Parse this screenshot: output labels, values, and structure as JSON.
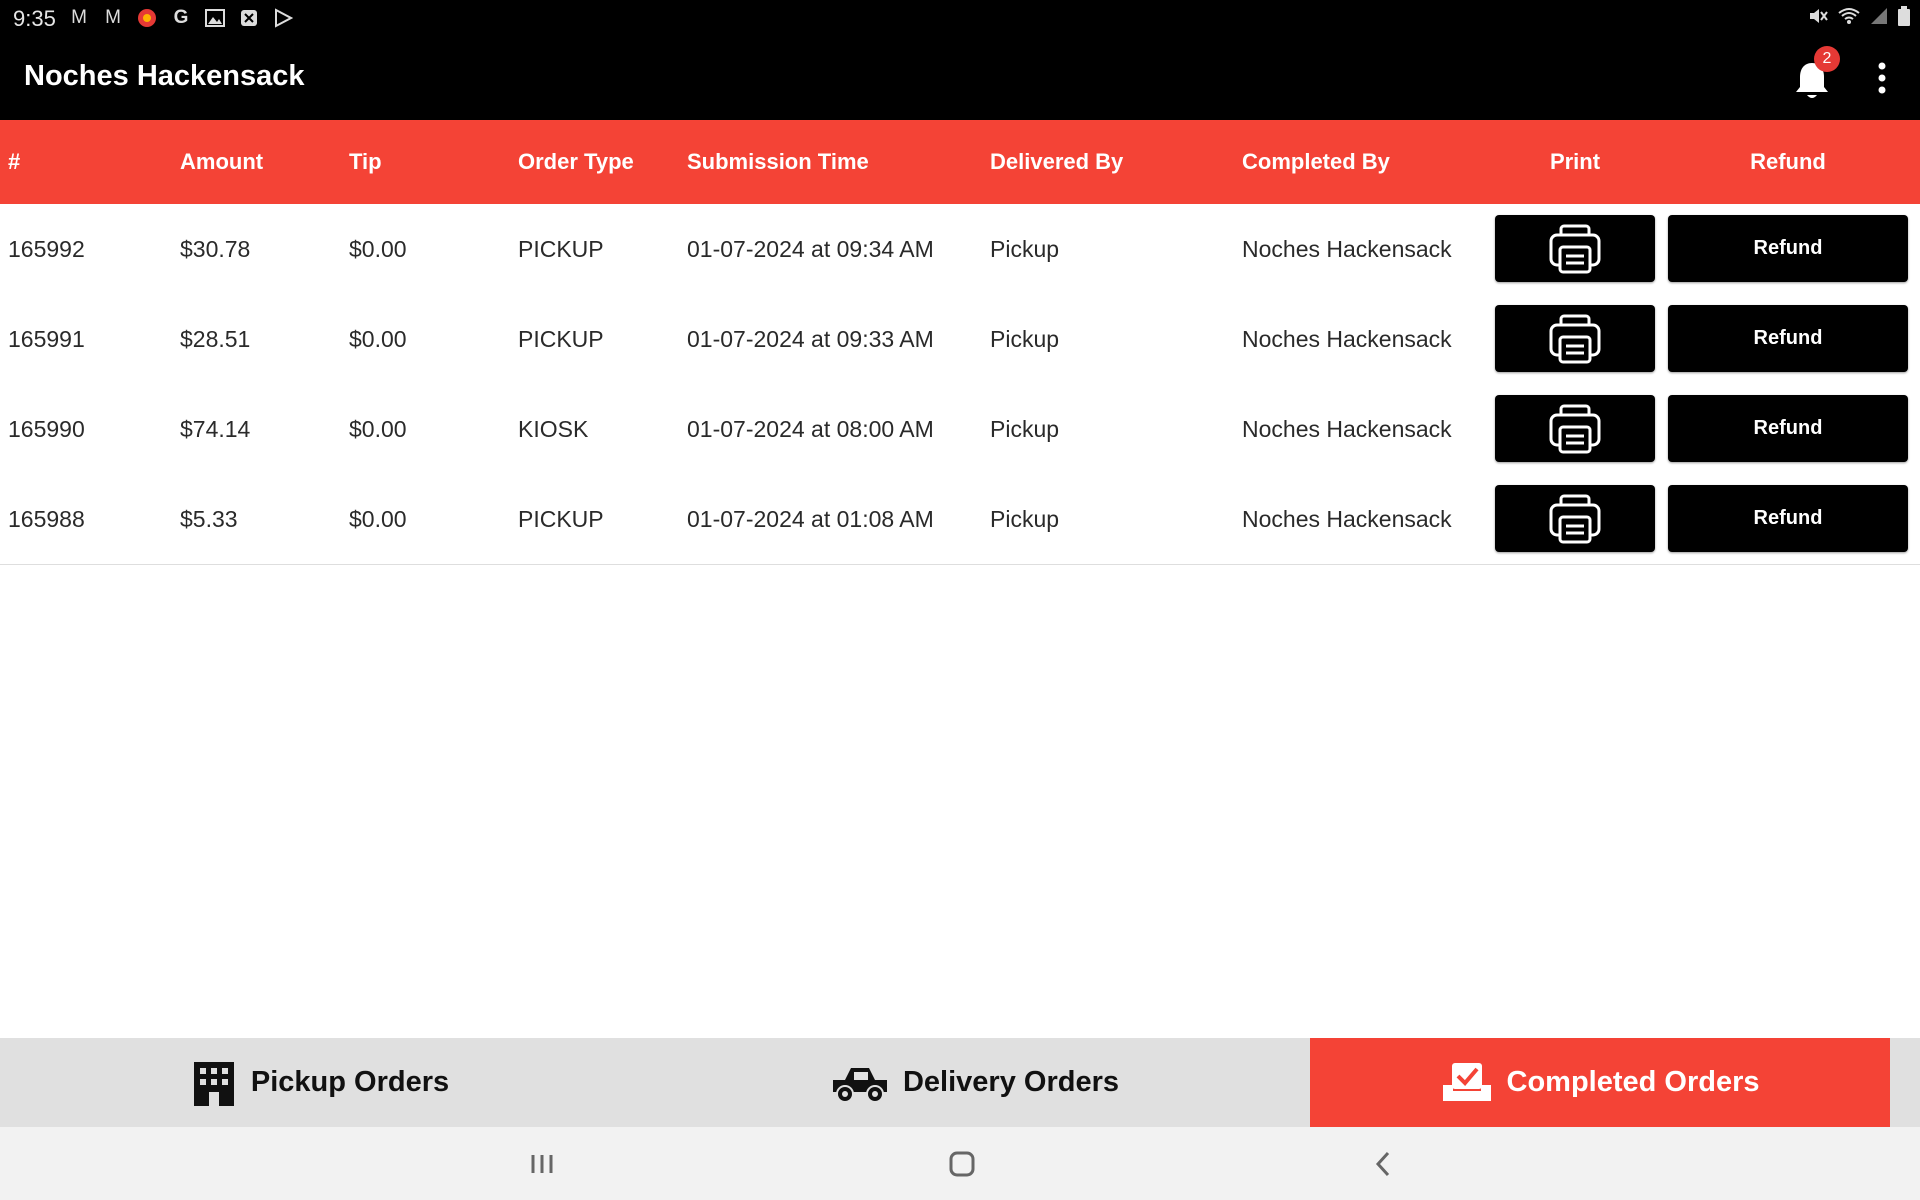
{
  "status_bar": {
    "time": "9:35",
    "notification_icons": [
      "gmail-icon",
      "gmail-icon",
      "app-icon",
      "google-icon",
      "gallery-icon",
      "app-icon",
      "play-store-icon"
    ],
    "right_icons": [
      "mute-icon",
      "wifi-icon",
      "signal-icon",
      "battery-icon"
    ]
  },
  "app_bar": {
    "title": "Noches Hackensack",
    "notification_count": "2"
  },
  "table": {
    "headers": {
      "number": "#",
      "amount": "Amount",
      "tip": "Tip",
      "order_type": "Order Type",
      "submission_time": "Submission Time",
      "delivered_by": "Delivered By",
      "completed_by": "Completed By",
      "print": "Print",
      "refund": "Refund"
    },
    "rows": [
      {
        "number": "165992",
        "amount": "$30.78",
        "tip": "$0.00",
        "order_type": "PICKUP",
        "submission_time": "01-07-2024 at 09:34 AM",
        "delivered_by": "Pickup",
        "completed_by": "Noches Hackensack",
        "refund_label": "Refund"
      },
      {
        "number": "165991",
        "amount": "$28.51",
        "tip": "$0.00",
        "order_type": "PICKUP",
        "submission_time": "01-07-2024 at 09:33 AM",
        "delivered_by": "Pickup",
        "completed_by": "Noches Hackensack",
        "refund_label": "Refund"
      },
      {
        "number": "165990",
        "amount": "$74.14",
        "tip": "$0.00",
        "order_type": "KIOSK",
        "submission_time": "01-07-2024 at 08:00 AM",
        "delivered_by": "Pickup",
        "completed_by": "Noches Hackensack",
        "refund_label": "Refund"
      },
      {
        "number": "165988",
        "amount": "$5.33",
        "tip": "$0.00",
        "order_type": "PICKUP",
        "submission_time": "01-07-2024 at 01:08 AM",
        "delivered_by": "Pickup",
        "completed_by": "Noches Hackensack",
        "refund_label": "Refund"
      }
    ]
  },
  "bottom_tabs": [
    {
      "label": "Pickup Orders",
      "icon": "building-icon",
      "active": false
    },
    {
      "label": "Delivery Orders",
      "icon": "truck-icon",
      "active": false
    },
    {
      "label": "Completed Orders",
      "icon": "completed-tray-icon",
      "active": true
    }
  ],
  "colors": {
    "accent": "#f44336",
    "app_bar": "#000000",
    "button": "#000000",
    "badge": "#e53935",
    "tab_bar": "#e0e0e0"
  }
}
